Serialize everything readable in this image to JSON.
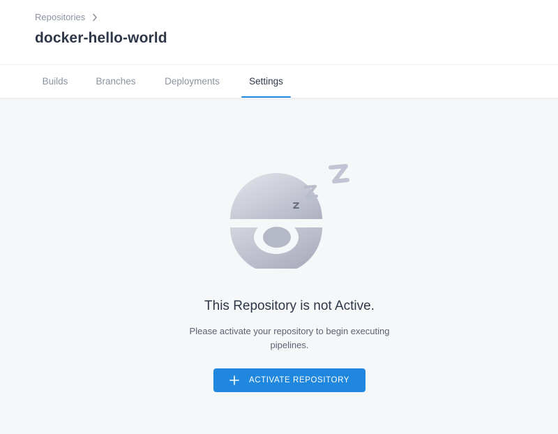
{
  "breadcrumb": {
    "label": "Repositories",
    "chevron_icon": "chevron-right-icon"
  },
  "repo": {
    "title": "docker-hello-world"
  },
  "tabs": [
    {
      "label": "Builds",
      "active": false
    },
    {
      "label": "Branches",
      "active": false
    },
    {
      "label": "Deployments",
      "active": false
    },
    {
      "label": "Settings",
      "active": true
    }
  ],
  "empty_state": {
    "illustration": "sleeping-ball-icon",
    "title": "This Repository is not Active.",
    "description": "Please activate your repository to begin executing pipelines."
  },
  "activate_button": {
    "label": "ACTIVATE REPOSITORY",
    "icon": "plus-icon"
  },
  "colors": {
    "accent": "#1f87dd",
    "title_text": "#2d3748",
    "muted_text": "#8b93a1",
    "page_background": "#f5f7f9"
  }
}
